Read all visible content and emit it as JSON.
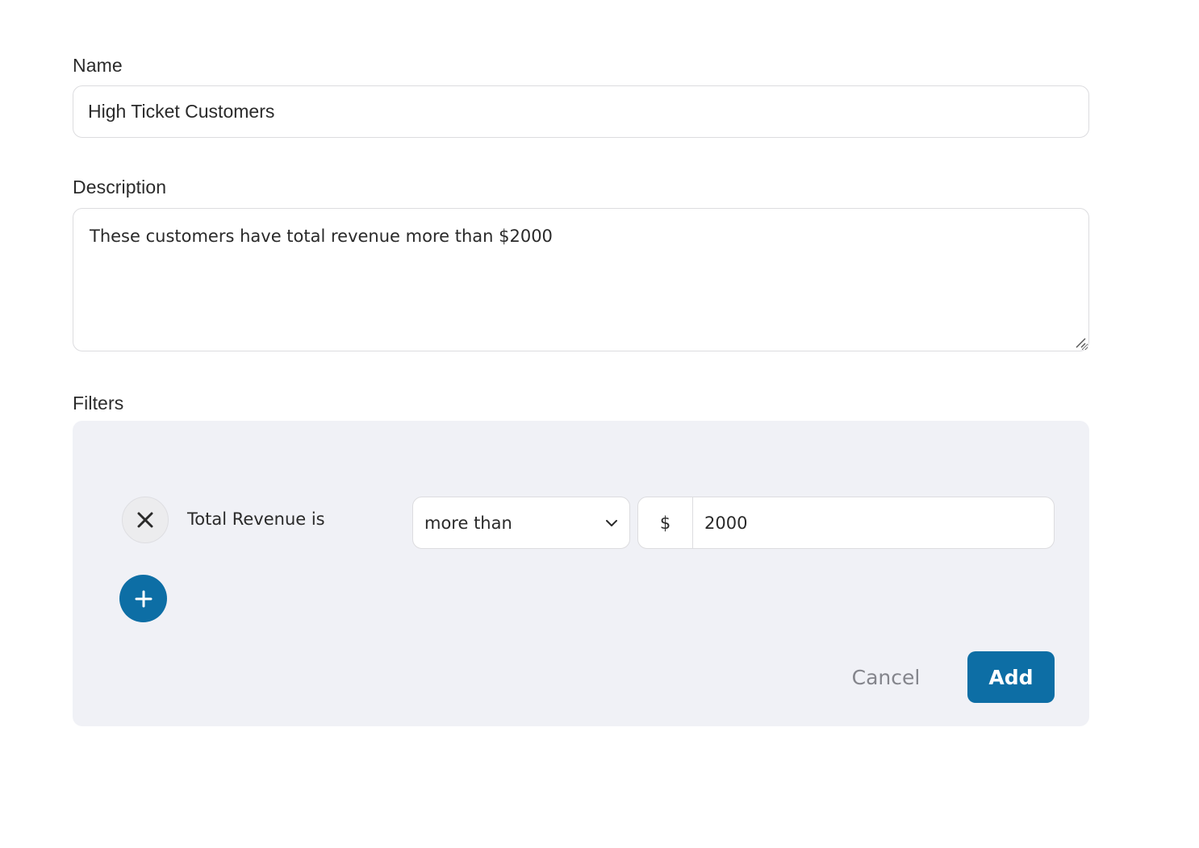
{
  "form": {
    "name_label": "Name",
    "name_value": "High Ticket Customers",
    "description_label": "Description",
    "description_value": "These customers have total revenue more than $2000",
    "filters_label": "Filters"
  },
  "filters": {
    "rows": [
      {
        "field_label": "Total Revenue is",
        "operator": "more than",
        "currency_symbol": "$",
        "amount": "2000",
        "remove_icon": "close-icon"
      }
    ],
    "add_icon": "plus-icon"
  },
  "actions": {
    "cancel_label": "Cancel",
    "add_label": "Add"
  },
  "colors": {
    "accent": "#0d6ea5",
    "panel_bg": "#f0f1f6",
    "muted_text": "#84858c"
  }
}
